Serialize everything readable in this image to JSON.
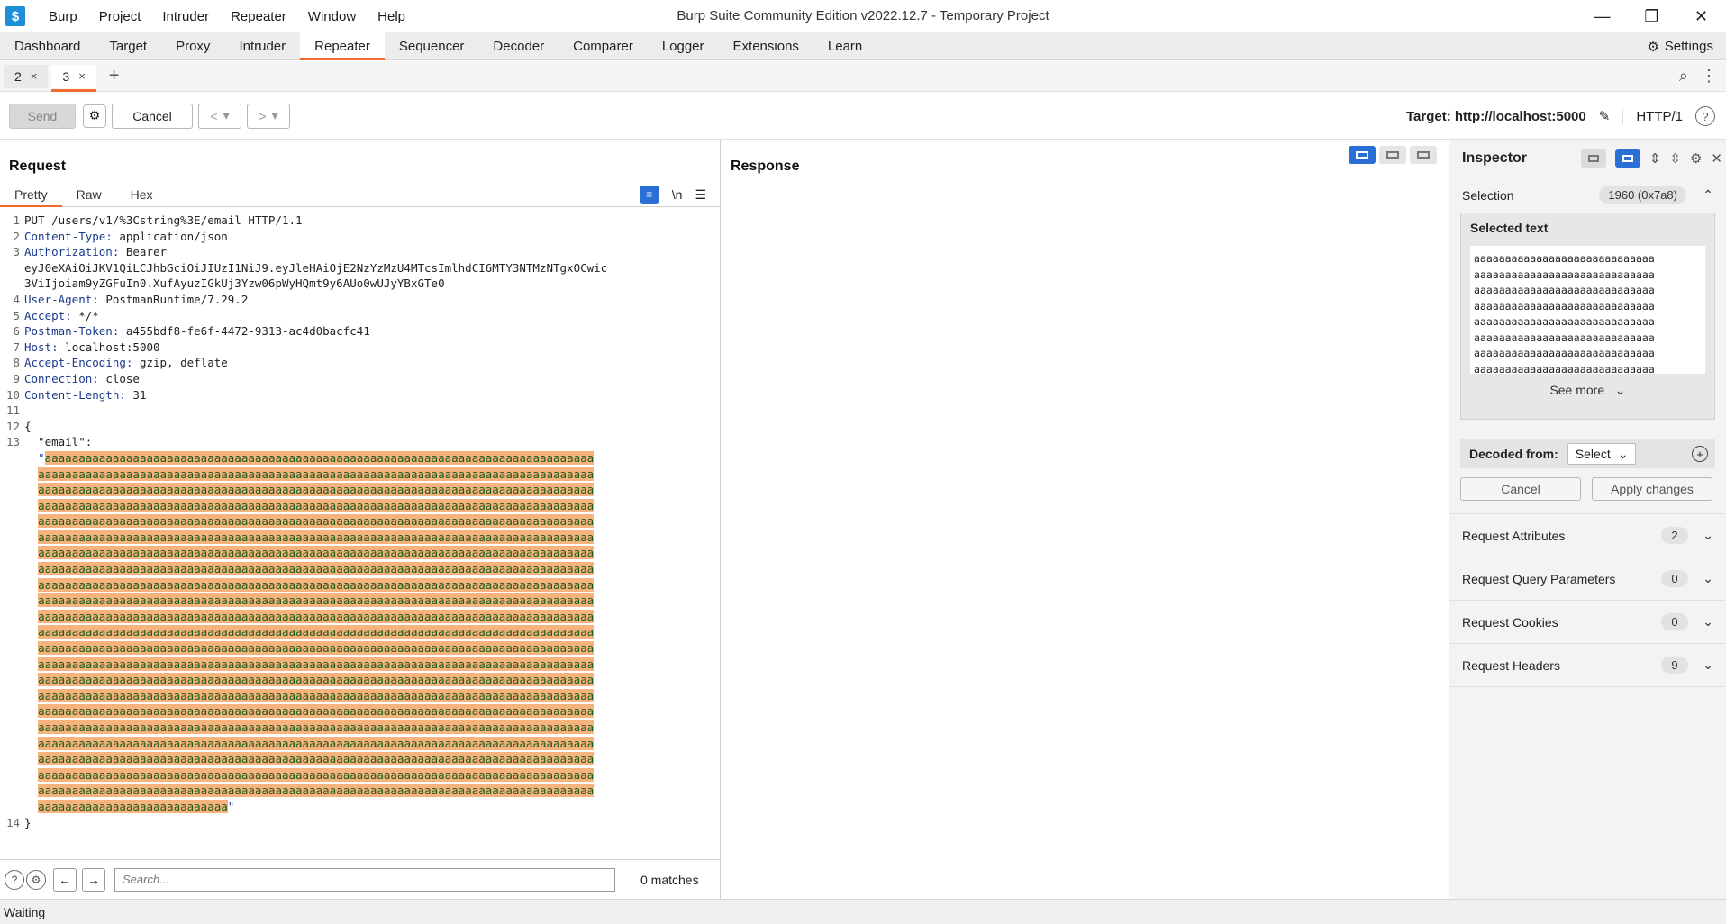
{
  "titlebar": {
    "title": "Burp Suite Community Edition v2022.12.7 - Temporary Project",
    "logo": "burp-logo",
    "menu": [
      "Burp",
      "Project",
      "Intruder",
      "Repeater",
      "Window",
      "Help"
    ]
  },
  "main_tabs": [
    "Dashboard",
    "Target",
    "Proxy",
    "Intruder",
    "Repeater",
    "Sequencer",
    "Decoder",
    "Comparer",
    "Logger",
    "Extensions",
    "Learn"
  ],
  "active_main_tab": "Repeater",
  "settings_label": "Settings",
  "repeater_tabs": [
    {
      "label": "2",
      "close": "×"
    },
    {
      "label": "3",
      "close": "×"
    }
  ],
  "add_tab_label": "+",
  "toolbar": {
    "send_label": "Send",
    "cancel_label": "Cancel",
    "back_label": "<",
    "forward_label": ">",
    "dropdown_glyph": "▾",
    "target_label": "Target: http://localhost:5000",
    "http_version": "HTTP/1"
  },
  "request": {
    "title": "Request",
    "view_tabs": [
      "Pretty",
      "Raw",
      "Hex"
    ],
    "newline_toggle": "\\n",
    "lines": [
      {
        "n": "1",
        "key": "",
        "text": "PUT /users/v1/%3Cstring%3E/email HTTP/1.1"
      },
      {
        "n": "2",
        "key": "Content-Type",
        "text": " application/json"
      },
      {
        "n": "3",
        "key": "Authorization",
        "text": " Bearer"
      },
      {
        "n": "",
        "key": "",
        "text": "eyJ0eXAiOiJKV1QiLCJhbGciOiJIUzI1NiJ9.eyJleHAiOjE2NzYzMzU4MTcsImlhdCI6MTY3NTMzNTgxOCwic"
      },
      {
        "n": "",
        "key": "",
        "text": "3ViIjoiam9yZGFuIn0.XufAyuzIGkUj3Yzw06pWyHQmt9y6AUo0wUJyYBxGTe0"
      },
      {
        "n": "4",
        "key": "User-Agent",
        "text": " PostmanRuntime/7.29.2"
      },
      {
        "n": "5",
        "key": "Accept",
        "text": " */*"
      },
      {
        "n": "6",
        "key": "Postman-Token",
        "text": " a455bdf8-fe6f-4472-9313-ac4d0bacfc41"
      },
      {
        "n": "7",
        "key": "Host",
        "text": " localhost:5000"
      },
      {
        "n": "8",
        "key": "Accept-Encoding",
        "text": " gzip, deflate"
      },
      {
        "n": "9",
        "key": "Connection",
        "text": " close"
      },
      {
        "n": "10",
        "key": "Content-Length",
        "text": " 31"
      },
      {
        "n": "11",
        "key": "",
        "text": ""
      },
      {
        "n": "12",
        "key": "",
        "text": "{"
      },
      {
        "n": "13",
        "key": "",
        "text": "  \"email\":"
      }
    ],
    "email_open_quote": "\"",
    "email_value_full_rows": 23,
    "email_value_row": "aaaaaaaaaaaaaaaaaaaaaaaaaaaaaaaaaaaaaaaaaaaaaaaaaaaaaaaaaaaaaaaaaaaaaaaaaaaaaaaaaa",
    "email_value_first_row": "aaaaaaaaaaaaaaaaaaaaaaaaaaaaaaaaaaaaaaaaaaaaaaaaaaaaaaaaaaaaaaaaaaaaaaaaaaaaaaaaa",
    "email_value_last_row": "aaaaaaaaaaaaaaaaaaaaaaaaaaaa",
    "email_close_quote": "\"",
    "closing_brace_line": {
      "n": "14",
      "text": "}"
    },
    "search_placeholder": "Search...",
    "matches": "0 matches"
  },
  "response": {
    "title": "Response"
  },
  "inspector": {
    "title": "Inspector",
    "selection_label": "Selection",
    "selection_value": "1960 (0x7a8)",
    "selected_text_title": "Selected text",
    "selected_text_rows": [
      "aaaaaaaaaaaaaaaaaaaaaaaaaaaaa",
      "aaaaaaaaaaaaaaaaaaaaaaaaaaaaa",
      "aaaaaaaaaaaaaaaaaaaaaaaaaaaaa",
      "aaaaaaaaaaaaaaaaaaaaaaaaaaaaa",
      "aaaaaaaaaaaaaaaaaaaaaaaaaaaaa",
      "aaaaaaaaaaaaaaaaaaaaaaaaaaaaa",
      "aaaaaaaaaaaaaaaaaaaaaaaaaaaaa",
      "aaaaaaaaaaaaaaaaaaaaaaaaaaaaa"
    ],
    "see_more": "See more",
    "decoded_from_label": "Decoded from:",
    "decoded_select": "Select",
    "cancel_label": "Cancel",
    "apply_label": "Apply changes",
    "sections": [
      {
        "label": "Request Attributes",
        "count": "2"
      },
      {
        "label": "Request Query Parameters",
        "count": "0"
      },
      {
        "label": "Request Cookies",
        "count": "0"
      },
      {
        "label": "Request Headers",
        "count": "9"
      }
    ]
  },
  "status": "Waiting",
  "colors": {
    "accent": "#f06b2d",
    "selection_bg": "#f7b37e",
    "toggle_blue": "#2a6fd6",
    "header_key": "#1a3a8c"
  }
}
